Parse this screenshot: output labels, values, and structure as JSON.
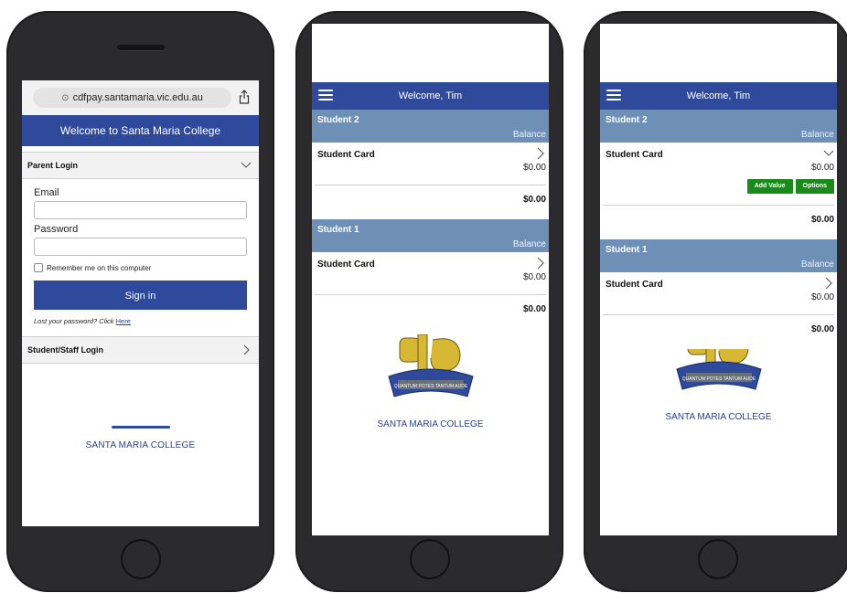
{
  "phone1": {
    "url": "cdfpay.santamaria.vic.edu.au",
    "banner": "Welcome to Santa Maria College",
    "parent_login": "Parent Login",
    "email_label": "Email",
    "email_value": "",
    "password_label": "Password",
    "password_value": "",
    "remember": "Remember me on this computer",
    "sign_in": "Sign in",
    "lost_prefix": "Lost your password? Click",
    "lost_link": "Here",
    "staff_login": "Student/Staff Login",
    "college_name": "SANTA MARIA COLLEGE"
  },
  "phone2": {
    "title": "Welcome, Tim",
    "students": [
      {
        "name": "Student 2",
        "balance_label": "Balance",
        "card_name": "Student Card",
        "card_amount": "$0.00",
        "total": "$0.00"
      },
      {
        "name": "Student 1",
        "balance_label": "Balance",
        "card_name": "Student Card",
        "card_amount": "$0.00",
        "total": "$0.00"
      }
    ],
    "college_name": "SANTA MARIA COLLEGE",
    "motto": "QUANTUM POTES TANTUM AUDE"
  },
  "phone3": {
    "title": "Welcome, Tim",
    "students": [
      {
        "name": "Student 2",
        "balance_label": "Balance",
        "card_name": "Student Card",
        "card_amount": "$0.00",
        "total": "$0.00",
        "add_value": "Add Value",
        "options": "Options"
      },
      {
        "name": "Student 1",
        "balance_label": "Balance",
        "card_name": "Student Card",
        "card_amount": "$0.00",
        "total": "$0.00"
      }
    ],
    "college_name": "SANTA MARIA COLLEGE",
    "motto": "QUANTUM POTES TANTUM AUDE"
  },
  "colors": {
    "brand_blue": "#2f4a9a",
    "student_header": "#6e8fb6",
    "action_green": "#1a8a1a",
    "crest_gold": "#d8b734"
  },
  "icons": [
    "lock-icon",
    "share-icon",
    "chevron-down-icon",
    "chevron-right-icon",
    "hamburger-menu-icon",
    "crest-logo"
  ]
}
